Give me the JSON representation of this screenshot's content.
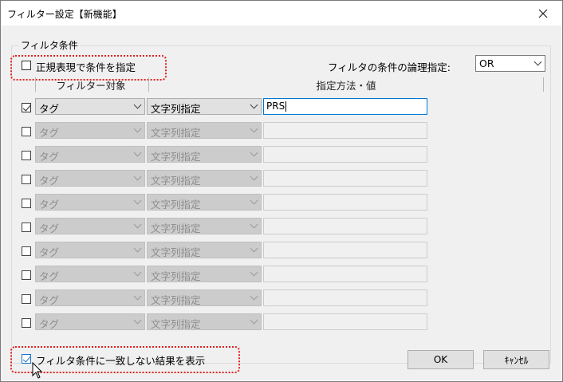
{
  "window": {
    "title": "フィルター設定【新機能】"
  },
  "group": {
    "legend": "フィルタ条件"
  },
  "regex": {
    "label": "正規表現で条件を指定",
    "checked": false
  },
  "logic": {
    "label": "フィルタの条件の論理指定:",
    "value": "OR"
  },
  "columns": {
    "target": "フィルター対象",
    "method": "指定方法・値"
  },
  "rows": [
    {
      "checked": true,
      "target": "タグ",
      "method": "文字列指定",
      "value": "PRS"
    },
    {
      "checked": false,
      "target": "タグ",
      "method": "文字列指定",
      "value": ""
    },
    {
      "checked": false,
      "target": "タグ",
      "method": "文字列指定",
      "value": ""
    },
    {
      "checked": false,
      "target": "タグ",
      "method": "文字列指定",
      "value": ""
    },
    {
      "checked": false,
      "target": "タグ",
      "method": "文字列指定",
      "value": ""
    },
    {
      "checked": false,
      "target": "タグ",
      "method": "文字列指定",
      "value": ""
    },
    {
      "checked": false,
      "target": "タグ",
      "method": "文字列指定",
      "value": ""
    },
    {
      "checked": false,
      "target": "タグ",
      "method": "文字列指定",
      "value": ""
    },
    {
      "checked": false,
      "target": "タグ",
      "method": "文字列指定",
      "value": ""
    },
    {
      "checked": false,
      "target": "タグ",
      "method": "文字列指定",
      "value": ""
    }
  ],
  "show_unmatched": {
    "label": "フィルタ条件に一致しない結果を表示",
    "checked": true
  },
  "buttons": {
    "ok": "OK",
    "cancel": "ｷｬﾝｾﾙ"
  },
  "colors": {
    "highlight": "#e02020",
    "accent": "#0078d7"
  }
}
